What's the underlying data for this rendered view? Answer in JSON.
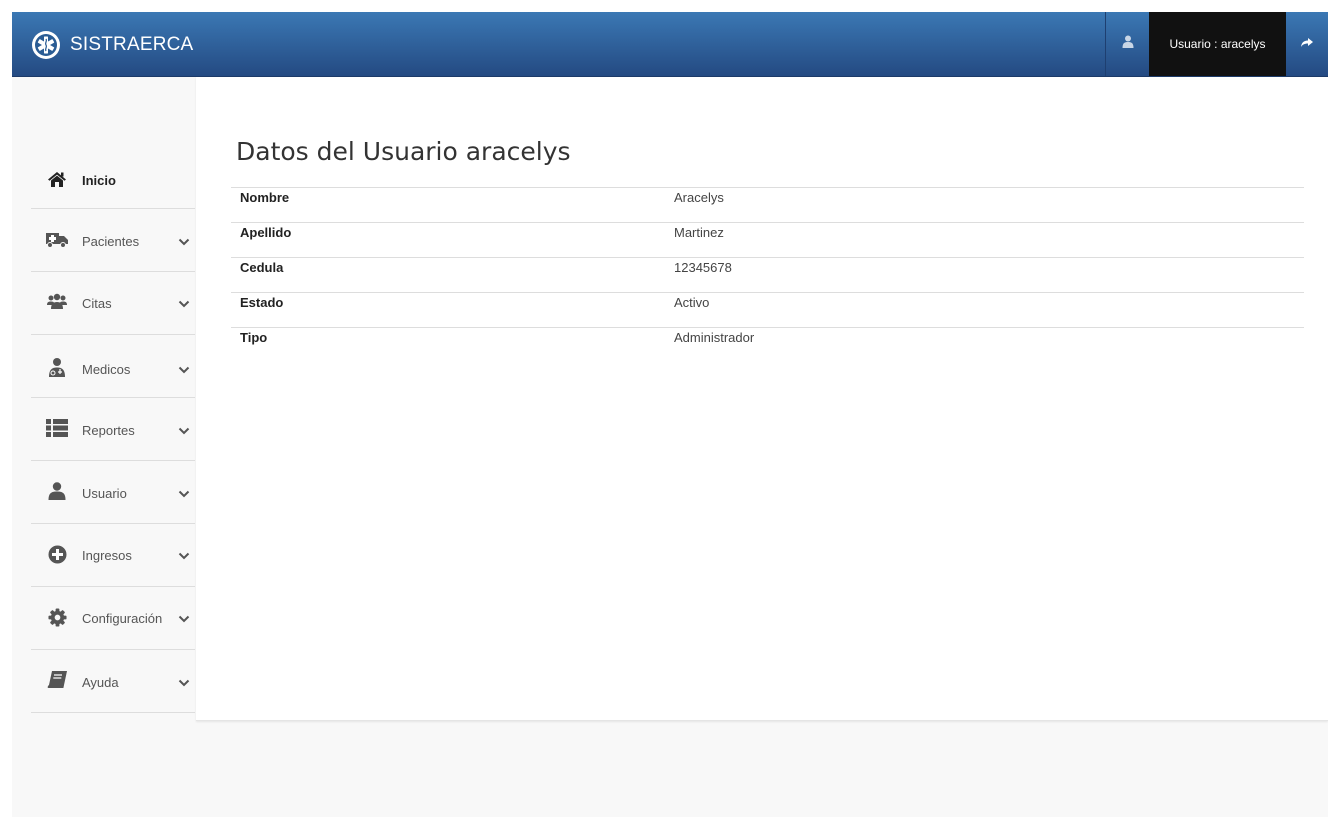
{
  "app": {
    "title": "SISTRAERCA"
  },
  "topbar": {
    "user_label": "Usuario : aracelys"
  },
  "sidebar": {
    "items": [
      {
        "label": "Inicio",
        "icon": "home-icon",
        "active": true
      },
      {
        "label": "Pacientes",
        "icon": "ambulance-icon"
      },
      {
        "label": "Citas",
        "icon": "users-icon"
      },
      {
        "label": "Medicos",
        "icon": "doctor-icon"
      },
      {
        "label": "Reportes",
        "icon": "list-icon"
      },
      {
        "label": "Usuario",
        "icon": "user-icon"
      },
      {
        "label": "Ingresos",
        "icon": "plus-circle-icon"
      },
      {
        "label": "Configuración",
        "icon": "gear-icon"
      },
      {
        "label": "Ayuda",
        "icon": "book-icon"
      }
    ]
  },
  "main": {
    "title": "Datos del Usuario aracelys",
    "rows": [
      {
        "key": "Nombre",
        "value": "Aracelys"
      },
      {
        "key": "Apellido",
        "value": "Martinez"
      },
      {
        "key": "Cedula",
        "value": "12345678"
      },
      {
        "key": "Estado",
        "value": "Activo"
      },
      {
        "key": "Tipo",
        "value": "Administrador"
      }
    ]
  },
  "colors": {
    "navbar_top": "#3b78b4",
    "navbar_bottom": "#244a82",
    "user_cell": "#111111",
    "icon_gray": "#555555"
  }
}
